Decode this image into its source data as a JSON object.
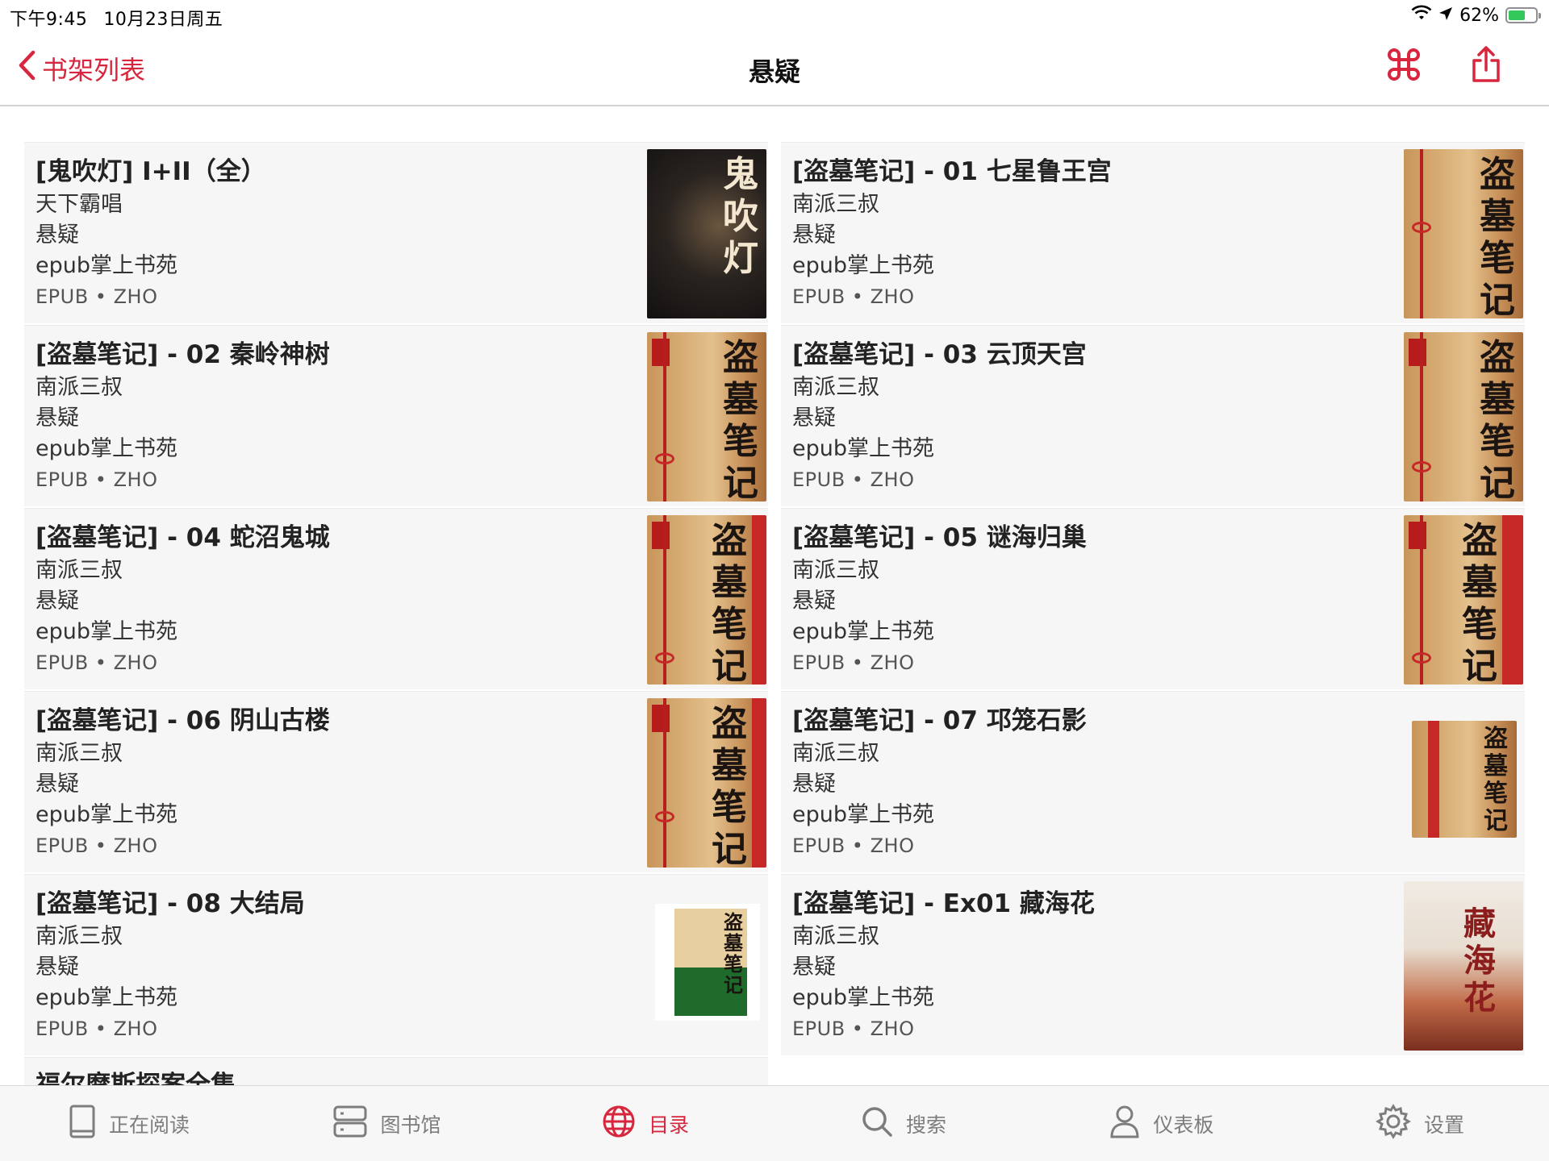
{
  "status_bar": {
    "time": "下午9:45",
    "date": "10月23日周五",
    "battery": "62%",
    "battery_level": 0.62,
    "accent": "#34c759"
  },
  "nav": {
    "back_label": "书架列表",
    "title": "悬疑",
    "accent": "#d7263d",
    "actions": [
      "command-icon",
      "share-icon"
    ]
  },
  "books": [
    {
      "title": "[鬼吹灯] I+II（全）",
      "author": "天下霸唱",
      "category": "悬疑",
      "publisher": "epub掌上书苑",
      "format": "EPUB • ZHO",
      "cover_glyphs": "鬼吹灯"
    },
    {
      "title": "[盗墓笔记] - 01 七星鲁王宫",
      "author": "南派三叔",
      "category": "悬疑",
      "publisher": "epub掌上书苑",
      "format": "EPUB • ZHO",
      "cover_glyphs": "盗墓笔记"
    },
    {
      "title": "[盗墓笔记] - 02 秦岭神树",
      "author": "南派三叔",
      "category": "悬疑",
      "publisher": "epub掌上书苑",
      "format": "EPUB • ZHO",
      "cover_glyphs": "盗墓笔记"
    },
    {
      "title": "[盗墓笔记] - 03 云顶天宫",
      "author": "南派三叔",
      "category": "悬疑",
      "publisher": "epub掌上书苑",
      "format": "EPUB • ZHO",
      "cover_glyphs": "盗墓笔记"
    },
    {
      "title": "[盗墓笔记] - 04 蛇沼鬼城",
      "author": "南派三叔",
      "category": "悬疑",
      "publisher": "epub掌上书苑",
      "format": "EPUB • ZHO",
      "cover_glyphs": "盗墓笔记"
    },
    {
      "title": "[盗墓笔记] - 05 谜海归巢",
      "author": "南派三叔",
      "category": "悬疑",
      "publisher": "epub掌上书苑",
      "format": "EPUB • ZHO",
      "cover_glyphs": "盗墓笔记"
    },
    {
      "title": "[盗墓笔记] - 06 阴山古楼",
      "author": "南派三叔",
      "category": "悬疑",
      "publisher": "epub掌上书苑",
      "format": "EPUB • ZHO",
      "cover_glyphs": "盗墓笔记"
    },
    {
      "title": "[盗墓笔记] - 07 邛笼石影",
      "author": "南派三叔",
      "category": "悬疑",
      "publisher": "epub掌上书苑",
      "format": "EPUB • ZHO",
      "cover_glyphs": "盗墓笔记"
    },
    {
      "title": "[盗墓笔记] - 08 大结局",
      "author": "南派三叔",
      "category": "悬疑",
      "publisher": "epub掌上书苑",
      "format": "EPUB • ZHO",
      "cover_glyphs": "盗墓笔记"
    },
    {
      "title": "[盗墓笔记] - Ex01 藏海花",
      "author": "南派三叔",
      "category": "悬疑",
      "publisher": "epub掌上书苑",
      "format": "EPUB • ZHO",
      "cover_glyphs": "藏海花"
    }
  ],
  "partial_book": {
    "title": "福尔摩斯探案全集"
  },
  "tabs": [
    {
      "label": "正在阅读",
      "icon": "book-icon"
    },
    {
      "label": "图书馆",
      "icon": "server-icon"
    },
    {
      "label": "目录",
      "icon": "globe-icon",
      "active": true
    },
    {
      "label": "搜索",
      "icon": "search-icon"
    },
    {
      "label": "仪表板",
      "icon": "person-icon"
    },
    {
      "label": "设置",
      "icon": "gear-icon"
    }
  ]
}
